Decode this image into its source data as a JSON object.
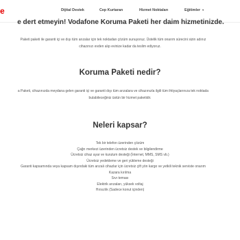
{
  "header": {
    "brand_fragment": "e",
    "nav": [
      {
        "label": "Dijital Destek"
      },
      {
        "label": "Cep Kurtaran"
      },
      {
        "label": "Hizmet Noktaları"
      },
      {
        "label": "Eğitimler",
        "has_dropdown": true
      }
    ]
  },
  "hero": {
    "headline": "e dert etmeyin! Vodafone Koruma Paketi her daim hizmetinizde."
  },
  "intro": {
    "line1": "Paketi paketi ile garanti içi ve dışı tüm arızalar için tek noktadan çözüm sunuyoruz. Üstelik tüm onarım sürecini sizin adınız",
    "line2": "cihazınızı evden alıp evinize kadar da teslim ediyoruz."
  },
  "what_is": {
    "title": "Koruma Paketi nedir?",
    "line1": "a Paketi, cihazınızda meydana gelen garanti içi ve garanti dışı tüm arızalara ve cihazınızla ilgili tüm ihtiyaçlarınıza tek noktada",
    "line2": "bulabileceğiniz üstün bir hizmet paketidir."
  },
  "coverage": {
    "title": "Neleri kapsar?",
    "items": [
      "Tek bir telefon üzerinden çözüm",
      "Çağrı merkezi üzerinden ücretsiz destek ve bilgilendirme",
      "Ücretsiz cihaz ayar ve kurulum desteği (İnternet, MMS, SMS vb.)",
      "Ücretsiz yedekleme ve geri yükleme desteği",
      "Garanti kapsamında veya kapsam dışındaki tüm arızalı cihazlar için ücretsiz çift yön kargo ve yetkili teknik serviste onarım",
      "Kazara kırılma",
      "Sıvı teması",
      "Elektrik arızaları, yüksek voltaj",
      "Hırsızlık (Sadece konut içinden)"
    ]
  },
  "colors": {
    "brand": "#e60000",
    "heading": "#333333",
    "body_text": "#555555"
  }
}
